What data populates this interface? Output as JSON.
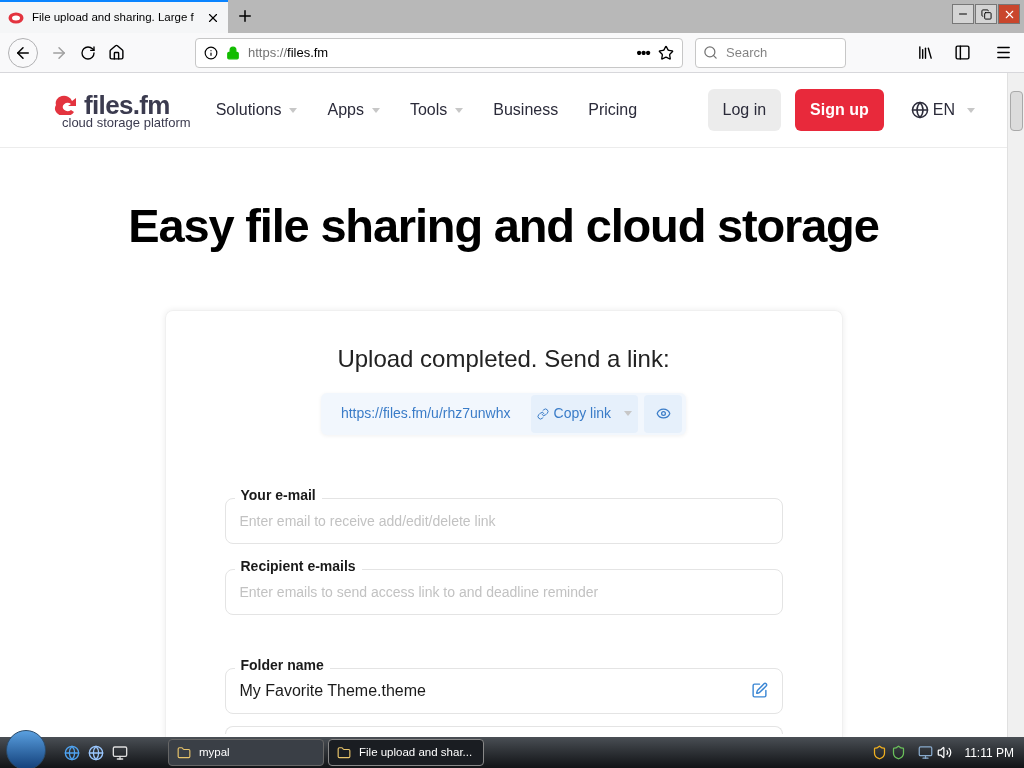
{
  "browser": {
    "tab": {
      "title": "File upload and sharing. Large f",
      "selected": true
    },
    "url_prefix": "https://",
    "url_host": "files.fm",
    "page_actions": "•••",
    "search": {
      "placeholder": "Search"
    }
  },
  "site": {
    "logo": {
      "name": "files.fm",
      "tagline": "cloud storage platform"
    },
    "nav": [
      {
        "label": "Solutions",
        "dropdown": true
      },
      {
        "label": "Apps",
        "dropdown": true
      },
      {
        "label": "Tools",
        "dropdown": true
      },
      {
        "label": "Business",
        "dropdown": false
      },
      {
        "label": "Pricing",
        "dropdown": false
      }
    ],
    "login": "Log in",
    "signup": "Sign up",
    "language": "EN"
  },
  "heading": "Easy file sharing and cloud storage",
  "card": {
    "title": "Upload completed. Send a link:",
    "link": "https://files.fm/u/rhz7unwhx",
    "copy": "Copy link",
    "fields": [
      {
        "label": "Your e-mail",
        "placeholder": "Enter email to receive add/edit/delete link",
        "kind": "text"
      },
      {
        "label": "Recipient e-mails",
        "placeholder": "Enter emails to send access link to and deadline reminder",
        "kind": "text"
      },
      {
        "label": "Folder name",
        "value": "My Favorite Theme.theme",
        "kind": "editable"
      }
    ]
  },
  "taskbar": {
    "items": [
      {
        "label": "mypal",
        "selected": false
      },
      {
        "label": "File upload and shar...",
        "selected": true
      }
    ],
    "clock": "11:11 PM"
  }
}
